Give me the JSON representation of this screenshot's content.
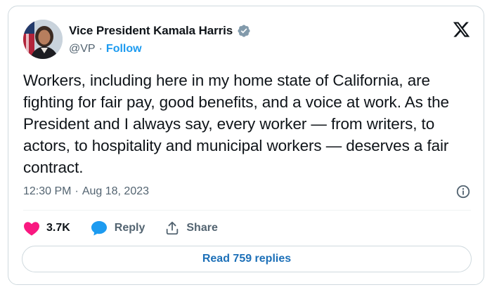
{
  "author": {
    "name": "Vice President Kamala Harris",
    "handle": "@VP",
    "separator": "·",
    "follow_label": "Follow",
    "verified_badge_color": "#829aab",
    "avatar_icon": "profile-photo"
  },
  "platform_logo": "x-logo-icon",
  "tweet": {
    "text": "Workers, including here in my home state of California, are fighting for fair pay, good benefits, and a voice at work. As the President and I always say, every worker — from writers, to actors, to hospitality and municipal workers — deserves a fair contract.",
    "time": "12:30 PM",
    "separator": "·",
    "date": "Aug 18, 2023"
  },
  "actions": {
    "like_count": "3.7K",
    "reply_label": "Reply",
    "share_label": "Share"
  },
  "read_replies_label": "Read 759 replies",
  "colors": {
    "accent": "#1d9bf0",
    "like": "#f91880",
    "text": "#0f1419",
    "secondary": "#536471"
  }
}
